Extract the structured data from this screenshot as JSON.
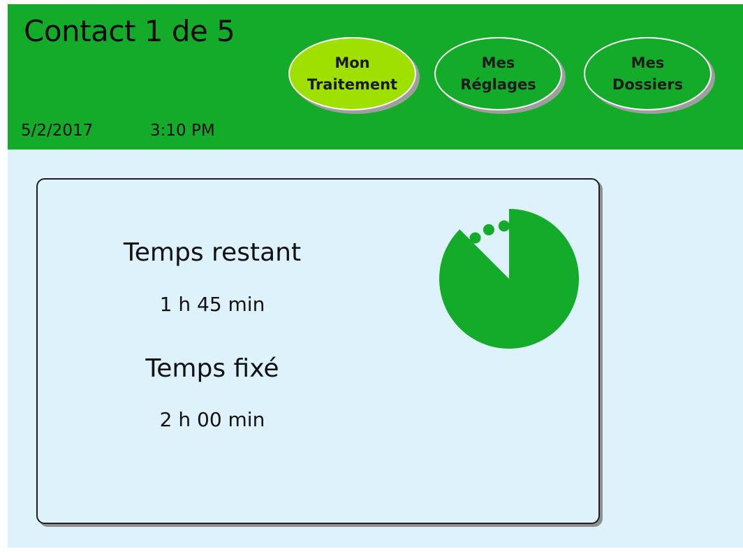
{
  "header": {
    "title": "Contact 1 de 5",
    "date": "5/2/2017",
    "time": "3:10 PM"
  },
  "nav": {
    "buttons": [
      {
        "line1": "Mon",
        "line2": "Traitement",
        "active": true
      },
      {
        "line1": "Mes",
        "line2": "Réglages",
        "active": false
      },
      {
        "line1": "Mes",
        "line2": "Dossiers",
        "active": false
      }
    ]
  },
  "card": {
    "remaining_label": "Temps restant",
    "remaining_value": "1 h 45 min",
    "set_label": "Temps fixé",
    "set_value": "2 h 00 min"
  },
  "timer": {
    "remaining_fraction": 0.875,
    "color": "#14ab2a"
  },
  "colors": {
    "header_bg": "#14ab2a",
    "active_button": "#9fe000",
    "panel_bg": "#def2fc"
  }
}
